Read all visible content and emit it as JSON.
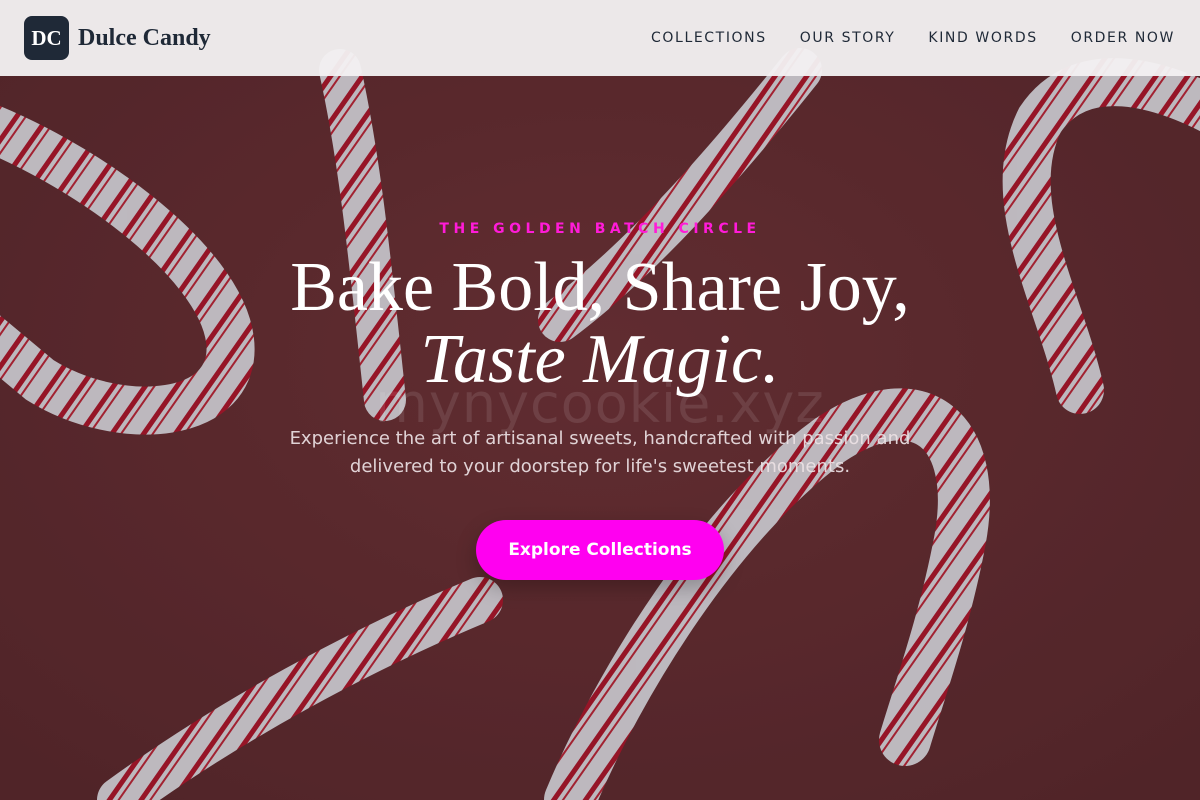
{
  "header": {
    "logo_initials": "DC",
    "brand_name": "Dulce Candy",
    "nav": [
      {
        "label": "COLLECTIONS"
      },
      {
        "label": "OUR STORY"
      },
      {
        "label": "KIND WORDS"
      },
      {
        "label": "ORDER NOW"
      }
    ]
  },
  "hero": {
    "eyebrow": "THE GOLDEN BATCH CIRCLE",
    "headline_line1": "Bake Bold, Share Joy,",
    "headline_line2": "Taste Magic.",
    "subtext": "Experience the art of artisanal sweets, handcrafted with passion and delivered to your doorstep for life's sweetest moments.",
    "cta_label": "Explore Collections",
    "watermark": "mynycookie.xyz",
    "background_image": "candy-canes-on-red"
  },
  "colors": {
    "accent": "#ff00f0",
    "eyebrow": "#ff1bd8",
    "logo_bg": "#1f2937",
    "hero_bg": "#6a3236",
    "cane_stripe": "#b3172c",
    "cane_white": "#e7eaef"
  }
}
